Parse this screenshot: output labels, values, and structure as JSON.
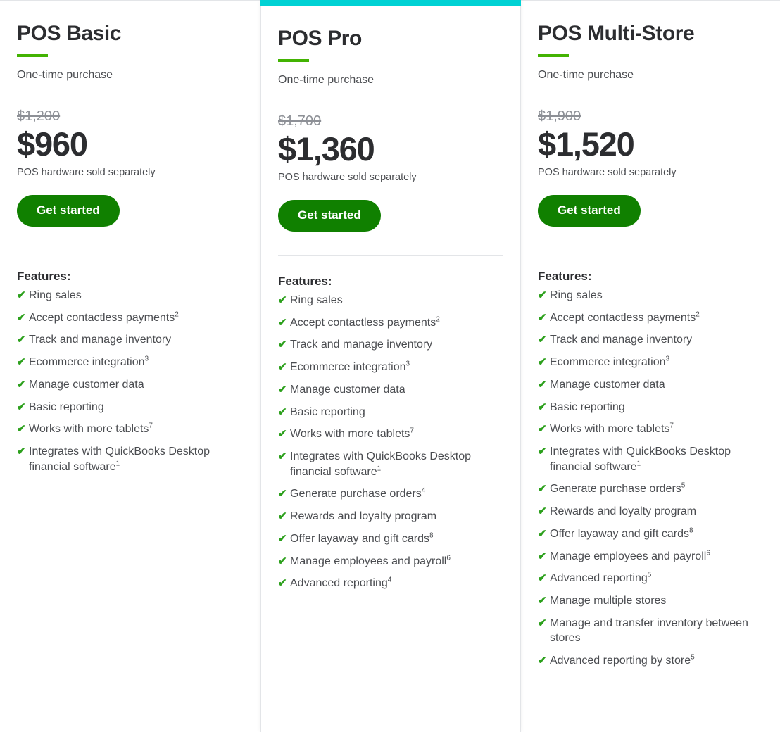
{
  "colors": {
    "accent_bar": "#00d2d4",
    "rule_green": "#43b302",
    "button_green": "#108000",
    "check_green": "#2ca01c",
    "text_dark": "#2c2d30",
    "text_body": "#4a4c50",
    "text_muted": "#8d9096",
    "border": "#e3e5e8"
  },
  "plans": [
    {
      "id": "pos-basic",
      "name": "POS Basic",
      "billing": "One-time purchase",
      "price_original": "$1,200",
      "price_current": "$960",
      "price_note": "POS hardware sold separately",
      "cta_label": "Get started",
      "features_heading": "Features:",
      "highlighted": false,
      "features": [
        {
          "text": "Ring sales",
          "sup": ""
        },
        {
          "text": "Accept contactless payments",
          "sup": "2"
        },
        {
          "text": "Track and manage inventory",
          "sup": ""
        },
        {
          "text": "Ecommerce integration",
          "sup": "3"
        },
        {
          "text": "Manage customer data",
          "sup": ""
        },
        {
          "text": "Basic reporting",
          "sup": ""
        },
        {
          "text": "Works with more tablets",
          "sup": "7"
        },
        {
          "text": "Integrates with QuickBooks Desktop financial software",
          "sup": "1"
        }
      ]
    },
    {
      "id": "pos-pro",
      "name": "POS Pro",
      "billing": "One-time purchase",
      "price_original": "$1,700",
      "price_current": "$1,360",
      "price_note": "POS hardware sold separately",
      "cta_label": "Get started",
      "features_heading": "Features:",
      "highlighted": true,
      "features": [
        {
          "text": "Ring sales",
          "sup": ""
        },
        {
          "text": "Accept contactless payments",
          "sup": "2"
        },
        {
          "text": "Track and manage inventory",
          "sup": ""
        },
        {
          "text": "Ecommerce integration",
          "sup": "3"
        },
        {
          "text": "Manage customer data",
          "sup": ""
        },
        {
          "text": "Basic reporting",
          "sup": ""
        },
        {
          "text": "Works with more tablets",
          "sup": "7"
        },
        {
          "text": "Integrates with QuickBooks Desktop financial software",
          "sup": "1"
        },
        {
          "text": "Generate purchase orders",
          "sup": "4"
        },
        {
          "text": "Rewards and loyalty program",
          "sup": ""
        },
        {
          "text": "Offer layaway and gift cards",
          "sup": "8"
        },
        {
          "text": "Manage employees and payroll",
          "sup": "6"
        },
        {
          "text": "Advanced reporting",
          "sup": "4"
        }
      ]
    },
    {
      "id": "pos-multi-store",
      "name": "POS Multi-Store",
      "billing": "One-time purchase",
      "price_original": "$1,900",
      "price_current": "$1,520",
      "price_note": "POS hardware sold separately",
      "cta_label": "Get started",
      "features_heading": "Features:",
      "highlighted": false,
      "features": [
        {
          "text": "Ring sales",
          "sup": ""
        },
        {
          "text": "Accept contactless payments",
          "sup": "2"
        },
        {
          "text": "Track and manage inventory",
          "sup": ""
        },
        {
          "text": "Ecommerce integration",
          "sup": "3"
        },
        {
          "text": "Manage customer data",
          "sup": ""
        },
        {
          "text": "Basic reporting",
          "sup": ""
        },
        {
          "text": "Works with more tablets",
          "sup": "7"
        },
        {
          "text": "Integrates with QuickBooks Desktop financial software",
          "sup": "1"
        },
        {
          "text": "Generate purchase orders",
          "sup": "5"
        },
        {
          "text": "Rewards and loyalty program",
          "sup": ""
        },
        {
          "text": "Offer layaway and gift cards",
          "sup": "8"
        },
        {
          "text": "Manage employees and payroll",
          "sup": "6"
        },
        {
          "text": "Advanced reporting",
          "sup": "5"
        },
        {
          "text": "Manage multiple stores",
          "sup": ""
        },
        {
          "text": "Manage and transfer inventory between stores",
          "sup": ""
        },
        {
          "text": "Advanced reporting by store",
          "sup": "5"
        }
      ]
    }
  ],
  "icons": {
    "check": "✔"
  }
}
